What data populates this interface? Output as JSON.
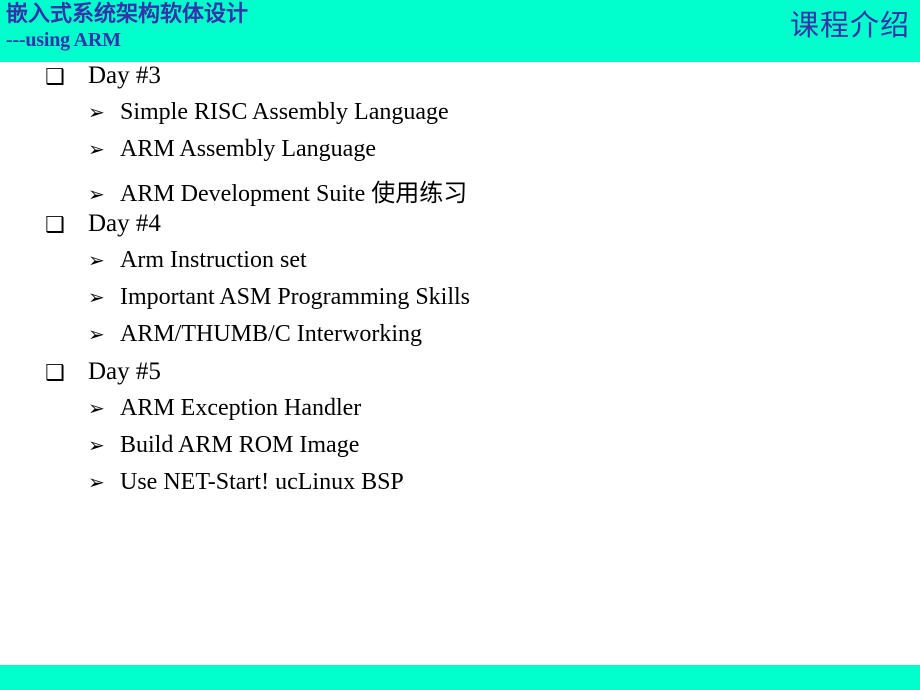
{
  "slide": {
    "background_color": "#FFFFFF",
    "band_color": "#00FFCC",
    "title_color": "#3333AA",
    "body_text_color": "#000000"
  },
  "header": {
    "title_cn": "嵌入式系统架构软体设计",
    "title_sub": "---using ARM",
    "section_label": "课程介绍"
  },
  "content": {
    "sections": [
      {
        "heading": "Day #3",
        "bullet_icon": "shadowed-square-bullet",
        "items": [
          {
            "text": "Simple RISC Assembly Language",
            "bullet_icon": "arrowhead-bullet"
          },
          {
            "text": "ARM Assembly Language",
            "bullet_icon": "arrowhead-bullet"
          },
          {
            "text": "ARM Development Suite 使用练习",
            "bullet_icon": "arrowhead-bullet"
          }
        ]
      },
      {
        "heading": "Day #4",
        "bullet_icon": "shadowed-square-bullet",
        "items": [
          {
            "text": "Arm Instruction set",
            "bullet_icon": "arrowhead-bullet"
          },
          {
            "text": "Important ASM Programming Skills",
            "bullet_icon": "arrowhead-bullet"
          },
          {
            "text": "ARM/THUMB/C Interworking",
            "bullet_icon": "arrowhead-bullet"
          }
        ]
      },
      {
        "heading": "Day #5",
        "bullet_icon": "shadowed-square-bullet",
        "items": [
          {
            "text": "ARM Exception Handler",
            "bullet_icon": "arrowhead-bullet"
          },
          {
            "text": "Build ARM ROM Image",
            "bullet_icon": "arrowhead-bullet"
          },
          {
            "text": "Use NET-Start! ucLinux BSP",
            "bullet_icon": "arrowhead-bullet"
          }
        ]
      }
    ]
  },
  "glyphs": {
    "square_bullet": "❑",
    "arrow_bullet": "➢"
  }
}
